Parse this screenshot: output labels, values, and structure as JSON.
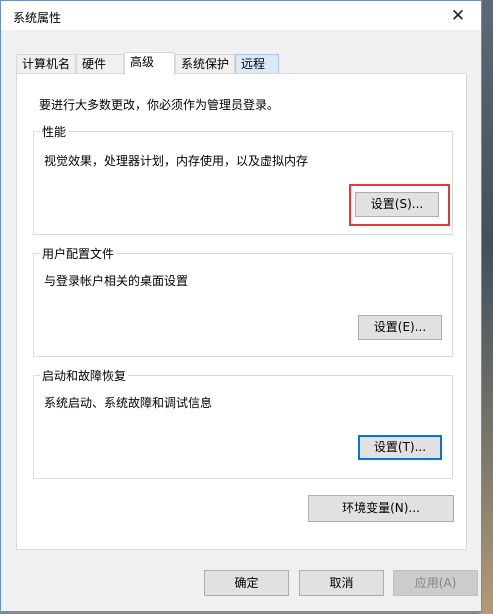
{
  "window": {
    "title": "系统属性",
    "close_glyph": "✕"
  },
  "tabs": [
    {
      "label": "计算机名",
      "active": false
    },
    {
      "label": "硬件",
      "active": false
    },
    {
      "label": "高级",
      "active": true
    },
    {
      "label": "系统保护",
      "active": false
    },
    {
      "label": "远程",
      "active": false
    }
  ],
  "advanced": {
    "admin_note": "要进行大多数更改，你必须作为管理员登录。",
    "performance": {
      "title": "性能",
      "description": "视觉效果，处理器计划，内存使用，以及虚拟内存",
      "button": "设置(S)..."
    },
    "user_profiles": {
      "title": "用户配置文件",
      "description": "与登录帐户相关的桌面设置",
      "button": "设置(E)..."
    },
    "startup_recovery": {
      "title": "启动和故障恢复",
      "description": "系统启动、系统故障和调试信息",
      "button": "设置(T)..."
    },
    "env_button": "环境变量(N)..."
  },
  "footer": {
    "ok": "确定",
    "cancel": "取消",
    "apply": "应用(A)"
  },
  "colors": {
    "highlight": "#e53935",
    "focus": "#0078d7",
    "window_border": "#6b8fb8"
  }
}
